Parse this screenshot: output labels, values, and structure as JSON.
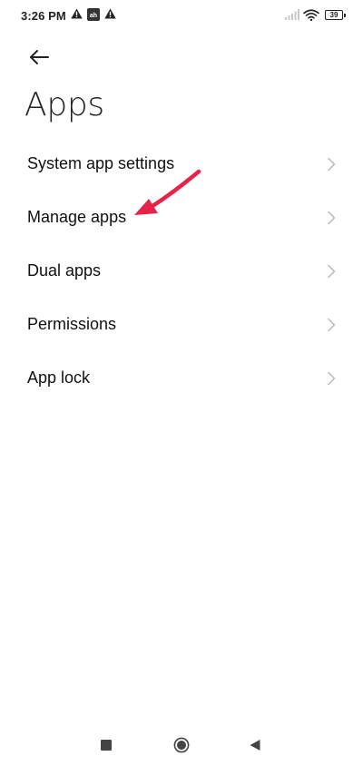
{
  "status_bar": {
    "time": "3:26 PM",
    "battery_level": "39",
    "icons": [
      "warning-icon",
      "app-badge-icon",
      "warning-icon",
      "signal-icon",
      "wifi-icon",
      "battery-icon"
    ]
  },
  "header": {
    "back_icon": "back-arrow-icon",
    "title": "Apps"
  },
  "settings": {
    "items": [
      {
        "label": "System app settings",
        "icon": "chevron-right-icon"
      },
      {
        "label": "Manage apps",
        "icon": "chevron-right-icon"
      },
      {
        "label": "Dual apps",
        "icon": "chevron-right-icon"
      },
      {
        "label": "Permissions",
        "icon": "chevron-right-icon"
      },
      {
        "label": "App lock",
        "icon": "chevron-right-icon"
      }
    ]
  },
  "annotation": {
    "color": "#e8234a",
    "points_to": "Manage apps"
  },
  "nav_bar": {
    "icons": [
      "recents-icon",
      "home-icon",
      "back-icon"
    ]
  },
  "colors": {
    "text_primary": "#111111",
    "chevron": "#b8b8b8",
    "annotation": "#e8234a"
  }
}
